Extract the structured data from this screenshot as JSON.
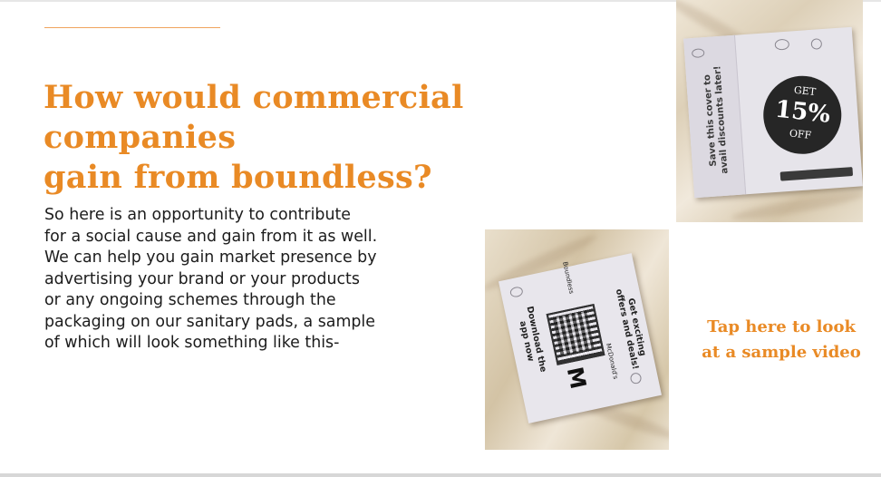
{
  "heading": "How would commercial companies\ngain from boundless?",
  "body": "So here is an opportunity to contribute\nfor a social cause and gain from it as well.\nWe can help you gain market presence by\nadvertising your brand or your products\nor any ongoing schemes through the\npackaging on our sanitary pads, a sample\nof which will look something like this-",
  "cta": "Tap here to look\nat a sample video",
  "photo1": {
    "side_text": "Save this cover to\navail discounts later!",
    "badge_top": "GET",
    "badge_value": "15%",
    "badge_bottom": "OFF"
  },
  "photo2": {
    "side_text_right": "Get exciting\noffers and deals!",
    "side_text_left": "Download the\napp now",
    "brand_logo": "M",
    "brand_name": "McDonald's",
    "maker_logo": "Boundless"
  },
  "colors": {
    "accent": "#e98a25",
    "body_text": "#1c1c1c"
  }
}
